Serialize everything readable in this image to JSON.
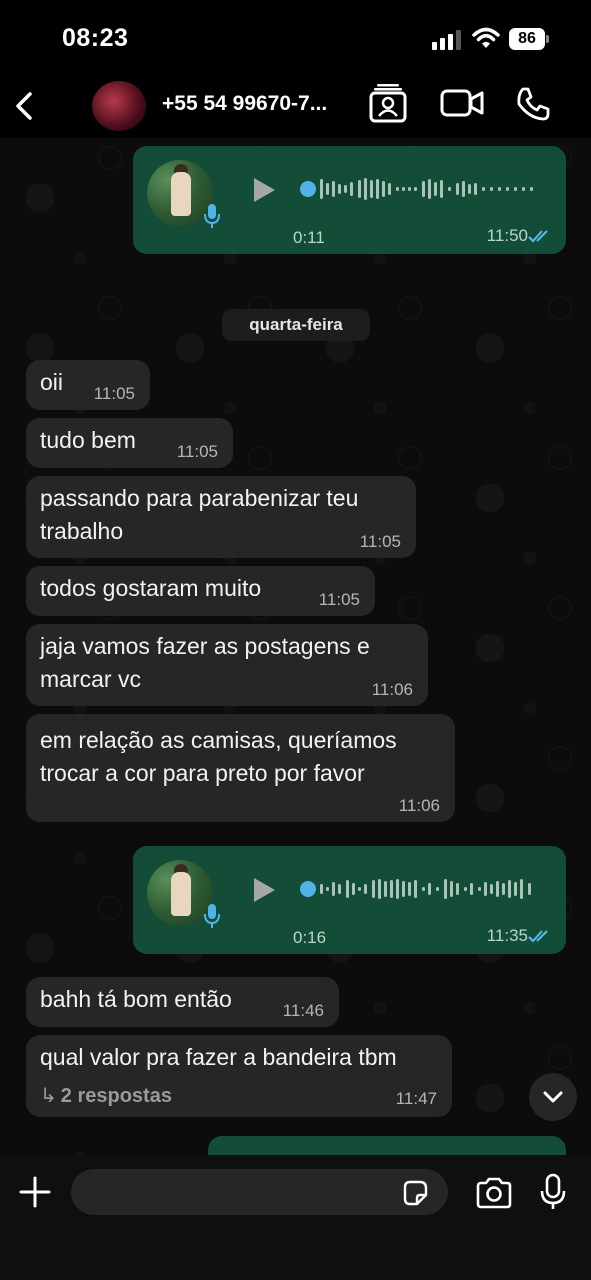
{
  "status_bar": {
    "time": "08:23",
    "battery": "86"
  },
  "header": {
    "contact_name": "+55 54 99670-7...",
    "icons": [
      "back-chevron-icon",
      "contact-card-icon",
      "video-call-icon",
      "phone-call-icon"
    ]
  },
  "messages": {
    "voice1": {
      "duration": "0:11",
      "time": "11:50",
      "status": "read"
    },
    "date_separator": "quarta-feira",
    "m1": {
      "text": "oii",
      "time": "11:05"
    },
    "m2": {
      "text": "tudo bem",
      "time": "11:05"
    },
    "m3": {
      "line1": "passando para parabenizar teu",
      "line2": "trabalho",
      "time": "11:05"
    },
    "m4": {
      "text": "todos gostaram muito",
      "time": "11:05"
    },
    "m5": {
      "line1": "jaja vamos fazer as postagens e",
      "line2": "marcar vc",
      "time": "11:06"
    },
    "m6": {
      "line1": "em relação as camisas, queríamos",
      "line2": "trocar a cor para preto por favor",
      "time": "11:06"
    },
    "voice2": {
      "duration": "0:16",
      "time": "11:35",
      "status": "read"
    },
    "m7": {
      "text": "bahh tá bom então",
      "time": "11:46"
    },
    "m8": {
      "text": "qual valor pra fazer a bandeira tbm",
      "replies": "2 respostas",
      "time": "11:47"
    }
  },
  "composer": {
    "placeholder": ""
  },
  "colors": {
    "outgoing": "#134d37",
    "incoming": "#262626",
    "read_ticks": "#53bdeb"
  }
}
